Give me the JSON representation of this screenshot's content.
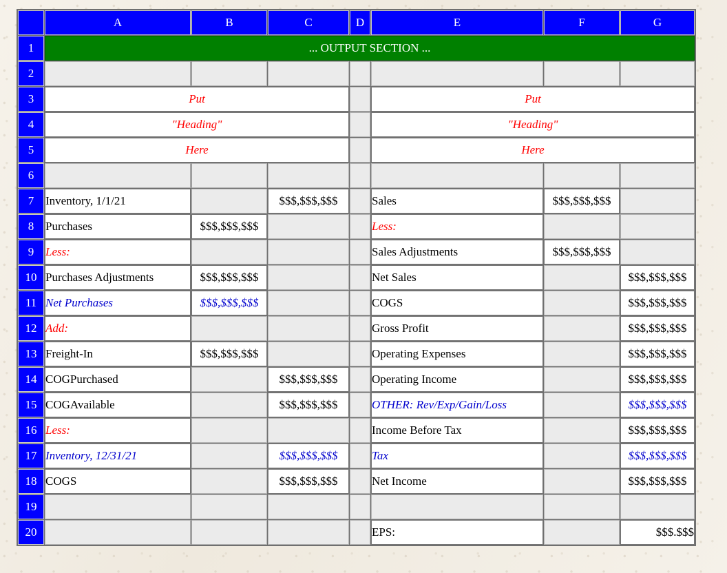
{
  "sheet": {
    "column_headers": [
      "A",
      "B",
      "C",
      "D",
      "E",
      "F",
      "G"
    ],
    "row_numbers": [
      "1",
      "2",
      "3",
      "4",
      "5",
      "6",
      "7",
      "8",
      "9",
      "10",
      "11",
      "12",
      "13",
      "14",
      "15",
      "16",
      "17",
      "18",
      "19",
      "20"
    ],
    "banner": {
      "text": "... OUTPUT SECTION ...",
      "color": "#008000",
      "text_color": "#ffffff",
      "span": "A1:G1"
    },
    "colors": {
      "header_blue": "#0000ff",
      "banner_green": "#008000",
      "empty_cell_grey": "#ebebeb",
      "filled_cell_white": "#ffffff",
      "accent_red": "#ff0000",
      "accent_blue": "#0000cd",
      "page_background": "#f3efe7"
    },
    "money_placeholder": "$$$,$$$,$$$",
    "eps_placeholder": "$$$.$$$",
    "heading_block_left": [
      {
        "row": "3",
        "text": "Put"
      },
      {
        "row": "4",
        "text": "\"Heading\""
      },
      {
        "row": "5",
        "text": "Here"
      }
    ],
    "heading_block_right": [
      {
        "row": "3",
        "text": "Put"
      },
      {
        "row": "4",
        "text": "\"Heading\""
      },
      {
        "row": "5",
        "text": "Here"
      }
    ],
    "rows": [
      {
        "n": "7",
        "a": {
          "text": "Inventory, 1/1/21",
          "style": "plain",
          "align": "left",
          "indent": 0
        },
        "b": {
          "text": "",
          "style": "empty"
        },
        "c": {
          "text": "$$$,$$$,$$$",
          "style": "plain",
          "align": "center"
        },
        "e": {
          "text": "Sales",
          "style": "plain",
          "align": "left",
          "indent": 0
        },
        "f": {
          "text": "$$$,$$$,$$$",
          "style": "plain",
          "align": "center"
        },
        "g": {
          "text": "",
          "style": "empty"
        }
      },
      {
        "n": "8",
        "a": {
          "text": "Purchases",
          "style": "plain",
          "align": "left",
          "indent": 0
        },
        "b": {
          "text": "$$$,$$$,$$$",
          "style": "plain",
          "align": "center"
        },
        "c": {
          "text": "",
          "style": "empty"
        },
        "e": {
          "text": "Less:",
          "style": "red",
          "align": "left",
          "indent": 0
        },
        "f": {
          "text": "",
          "style": "empty"
        },
        "g": {
          "text": "",
          "style": "empty"
        }
      },
      {
        "n": "9",
        "a": {
          "text": "Less:",
          "style": "red",
          "align": "left",
          "indent": 0
        },
        "b": {
          "text": "",
          "style": "empty"
        },
        "c": {
          "text": "",
          "style": "empty"
        },
        "e": {
          "text": "Sales Adjustments",
          "style": "plain",
          "align": "left",
          "indent": 2
        },
        "f": {
          "text": "$$$,$$$,$$$",
          "style": "plain",
          "align": "center"
        },
        "g": {
          "text": "",
          "style": "empty"
        }
      },
      {
        "n": "10",
        "a": {
          "text": "Purchases Adjustments",
          "style": "plain",
          "align": "left",
          "indent": 1
        },
        "b": {
          "text": "$$$,$$$,$$$",
          "style": "plain",
          "align": "center"
        },
        "c": {
          "text": "",
          "style": "empty"
        },
        "e": {
          "text": "Net Sales",
          "style": "plain",
          "align": "left",
          "indent": 0
        },
        "f": {
          "text": "",
          "style": "empty"
        },
        "g": {
          "text": "$$$,$$$,$$$",
          "style": "plain",
          "align": "center"
        }
      },
      {
        "n": "11",
        "a": {
          "text": "Net Purchases",
          "style": "blue",
          "align": "left",
          "indent": 0
        },
        "b": {
          "text": "$$$,$$$,$$$",
          "style": "blue",
          "align": "center"
        },
        "c": {
          "text": "",
          "style": "empty"
        },
        "e": {
          "text": "COGS",
          "style": "plain",
          "align": "left",
          "indent": 0
        },
        "f": {
          "text": "",
          "style": "empty"
        },
        "g": {
          "text": "$$$,$$$,$$$",
          "style": "plain",
          "align": "center"
        }
      },
      {
        "n": "12",
        "a": {
          "text": "Add:",
          "style": "red",
          "align": "left",
          "indent": 0
        },
        "b": {
          "text": "",
          "style": "empty"
        },
        "c": {
          "text": "",
          "style": "empty"
        },
        "e": {
          "text": "Gross Profit",
          "style": "plain",
          "align": "left",
          "indent": 0
        },
        "f": {
          "text": "",
          "style": "empty"
        },
        "g": {
          "text": "$$$,$$$,$$$",
          "style": "plain",
          "align": "center"
        }
      },
      {
        "n": "13",
        "a": {
          "text": "Freight-In",
          "style": "plain",
          "align": "left",
          "indent": 1
        },
        "b": {
          "text": "$$$,$$$,$$$",
          "style": "plain",
          "align": "center"
        },
        "c": {
          "text": "",
          "style": "empty"
        },
        "e": {
          "text": "Operating Expenses",
          "style": "plain",
          "align": "left",
          "indent": 0
        },
        "f": {
          "text": "",
          "style": "empty"
        },
        "g": {
          "text": "$$$,$$$,$$$",
          "style": "plain",
          "align": "center"
        }
      },
      {
        "n": "14",
        "a": {
          "text": "COGPurchased",
          "style": "plain",
          "align": "left",
          "indent": 0
        },
        "b": {
          "text": "",
          "style": "empty"
        },
        "c": {
          "text": "$$$,$$$,$$$",
          "style": "plain",
          "align": "center"
        },
        "e": {
          "text": "Operating Income",
          "style": "plain",
          "align": "left",
          "indent": 0
        },
        "f": {
          "text": "",
          "style": "empty"
        },
        "g": {
          "text": "$$$,$$$,$$$",
          "style": "plain",
          "align": "center"
        }
      },
      {
        "n": "15",
        "a": {
          "text": "COGAvailable",
          "style": "plain",
          "align": "left",
          "indent": 0
        },
        "b": {
          "text": "",
          "style": "empty"
        },
        "c": {
          "text": "$$$,$$$,$$$",
          "style": "plain",
          "align": "center"
        },
        "e": {
          "text": "OTHER: Rev/Exp/Gain/Loss",
          "style": "blue",
          "align": "left",
          "indent": 0
        },
        "f": {
          "text": "",
          "style": "empty"
        },
        "g": {
          "text": "$$$,$$$,$$$",
          "style": "blue",
          "align": "center"
        }
      },
      {
        "n": "16",
        "a": {
          "text": "Less:",
          "style": "red",
          "align": "left",
          "indent": 0
        },
        "b": {
          "text": "",
          "style": "empty"
        },
        "c": {
          "text": "",
          "style": "empty"
        },
        "e": {
          "text": "Income Before Tax",
          "style": "plain",
          "align": "left",
          "indent": 0
        },
        "f": {
          "text": "",
          "style": "empty"
        },
        "g": {
          "text": "$$$,$$$,$$$",
          "style": "plain",
          "align": "center"
        }
      },
      {
        "n": "17",
        "a": {
          "text": "Inventory, 12/31/21",
          "style": "blue",
          "align": "left",
          "indent": 1
        },
        "b": {
          "text": "",
          "style": "empty"
        },
        "c": {
          "text": "$$$,$$$,$$$",
          "style": "blue",
          "align": "center"
        },
        "e": {
          "text": "Tax",
          "style": "blue",
          "align": "left",
          "indent": 0
        },
        "f": {
          "text": "",
          "style": "empty"
        },
        "g": {
          "text": "$$$,$$$,$$$",
          "style": "blue",
          "align": "center"
        }
      },
      {
        "n": "18",
        "a": {
          "text": "COGS",
          "style": "plain",
          "align": "left",
          "indent": 0
        },
        "b": {
          "text": "",
          "style": "empty"
        },
        "c": {
          "text": "$$$,$$$,$$$",
          "style": "plain",
          "align": "center"
        },
        "e": {
          "text": "Net Income",
          "style": "plain",
          "align": "left",
          "indent": 0
        },
        "f": {
          "text": "",
          "style": "empty"
        },
        "g": {
          "text": "$$$,$$$,$$$",
          "style": "plain",
          "align": "center"
        }
      },
      {
        "n": "19",
        "a": {
          "text": "",
          "style": "empty"
        },
        "b": {
          "text": "",
          "style": "empty"
        },
        "c": {
          "text": "",
          "style": "empty"
        },
        "e": {
          "text": "",
          "style": "empty"
        },
        "f": {
          "text": "",
          "style": "empty"
        },
        "g": {
          "text": "",
          "style": "empty"
        }
      },
      {
        "n": "20",
        "a": {
          "text": "",
          "style": "empty"
        },
        "b": {
          "text": "",
          "style": "empty"
        },
        "c": {
          "text": "",
          "style": "empty"
        },
        "e": {
          "text": "EPS:",
          "style": "plain",
          "align": "left",
          "indent": 0
        },
        "f": {
          "text": "",
          "style": "empty"
        },
        "g": {
          "text": "$$$.$$$",
          "style": "plain",
          "align": "right"
        }
      }
    ]
  }
}
